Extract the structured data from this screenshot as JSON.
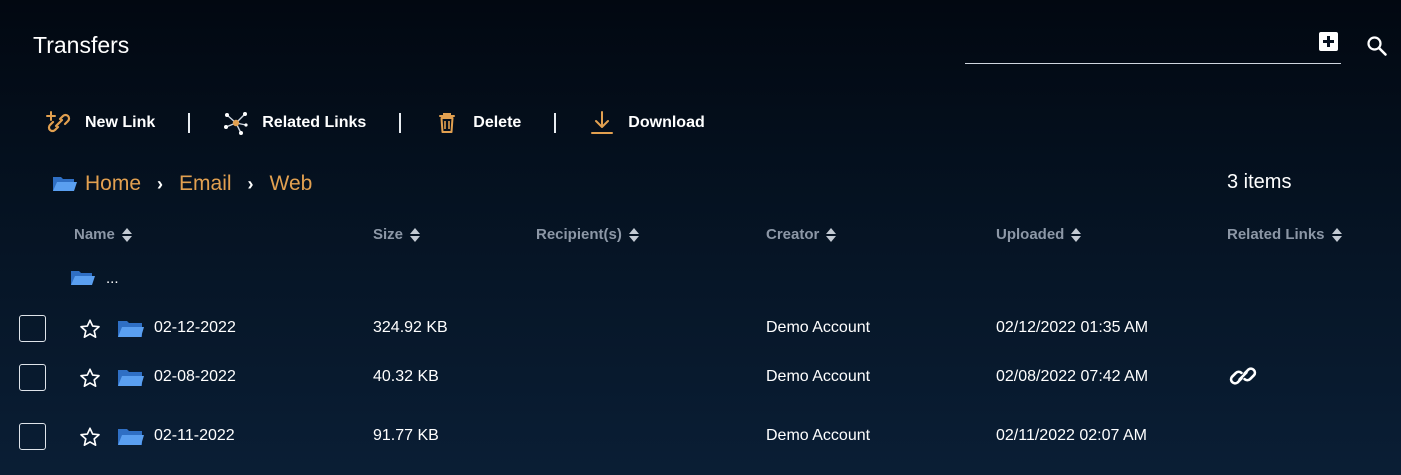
{
  "app": {
    "title": "Transfers"
  },
  "search": {
    "placeholder": ""
  },
  "toolbar": [
    {
      "label": "New Link",
      "icon": "link-add-icon"
    },
    {
      "label": "Related Links",
      "icon": "related-links-icon"
    },
    {
      "label": "Delete",
      "icon": "trash-icon"
    },
    {
      "label": "Download",
      "icon": "download-icon"
    }
  ],
  "breadcrumb": [
    "Home",
    "Email",
    "Web"
  ],
  "item_count": "3 items",
  "columns": {
    "name": "Name",
    "size": "Size",
    "recipients": "Recipient(s)",
    "creator": "Creator",
    "uploaded": "Uploaded",
    "related_links": "Related Links"
  },
  "parent_folder": {
    "label": "..."
  },
  "rows": [
    {
      "name": "02-12-2022",
      "size": "324.92 KB",
      "recipients": "",
      "creator": "Demo Account",
      "uploaded": "02/12/2022 01:35 AM",
      "has_related_link": false
    },
    {
      "name": "02-08-2022",
      "size": "40.32 KB",
      "recipients": "",
      "creator": "Demo Account",
      "uploaded": "02/08/2022 07:42 AM",
      "has_related_link": true
    },
    {
      "name": "02-11-2022",
      "size": "91.77 KB",
      "recipients": "",
      "creator": "Demo Account",
      "uploaded": "02/11/2022 02:07 AM",
      "has_related_link": false
    }
  ],
  "colors": {
    "accent": "#e2a050",
    "folder": "#4a8fe8",
    "muted": "#8c97a6"
  }
}
